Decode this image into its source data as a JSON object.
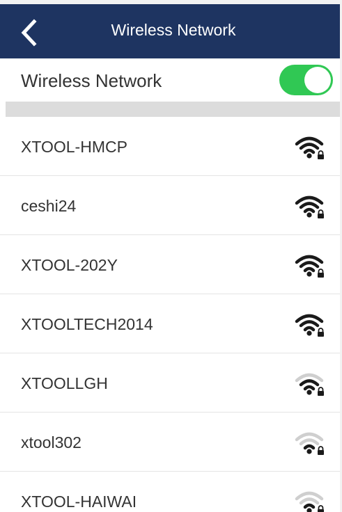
{
  "header": {
    "title": "Wireless Network",
    "back_icon": "chevron-left-icon",
    "background": "#1e3461"
  },
  "toggle_row": {
    "label": "Wireless Network",
    "enabled": true,
    "accent": "#30c854"
  },
  "networks": [
    {
      "ssid": "XTOOL-HMCP",
      "signal": "strong",
      "secured": true
    },
    {
      "ssid": "ceshi24",
      "signal": "strong",
      "secured": true
    },
    {
      "ssid": "XTOOL-202Y",
      "signal": "strong",
      "secured": true
    },
    {
      "ssid": "XTOOLTECH2014",
      "signal": "strong",
      "secured": true
    },
    {
      "ssid": "XTOOLLGH",
      "signal": "medium",
      "secured": true
    },
    {
      "ssid": "xtool302",
      "signal": "weak",
      "secured": true
    },
    {
      "ssid": "XTOOL-HAIWAI",
      "signal": "weak",
      "secured": true
    }
  ]
}
